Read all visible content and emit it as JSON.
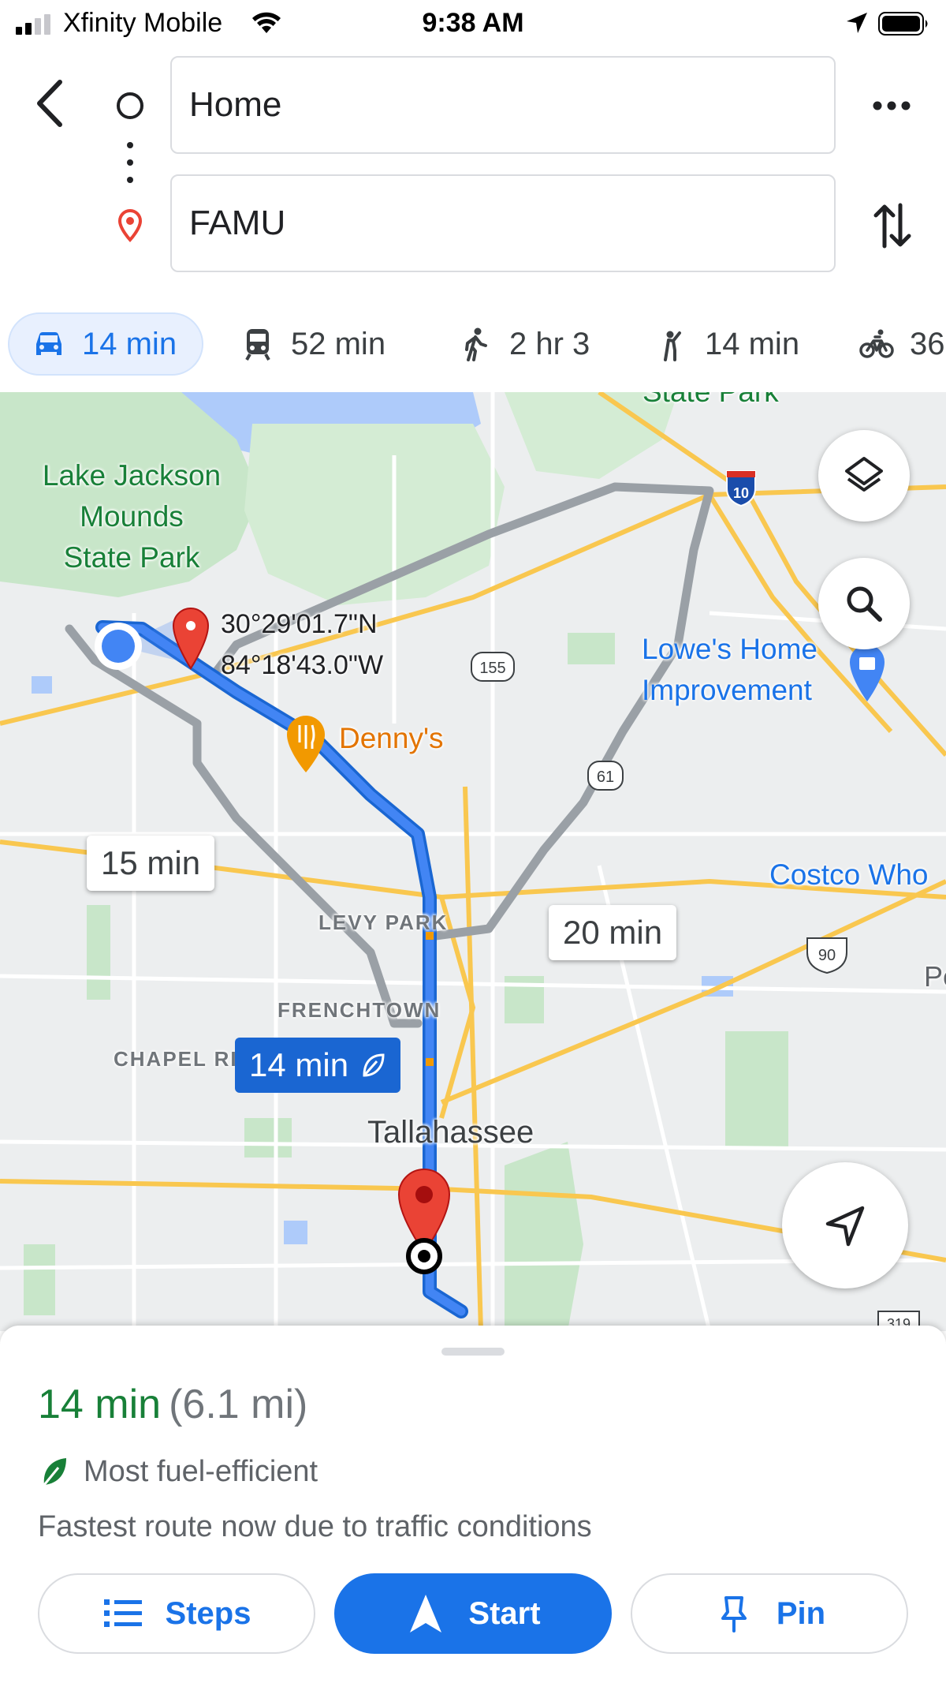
{
  "status_bar": {
    "carrier": "Xfinity Mobile",
    "time": "9:38 AM"
  },
  "header": {
    "origin_value": "Home",
    "destination_value": "FAMU"
  },
  "modes": {
    "drive": "14 min",
    "transit": "52 min",
    "walk": "2 hr 3",
    "ride": "14 min",
    "bike": "36"
  },
  "map": {
    "labels": {
      "park": "Lake Jackson\nMounds\nState Park",
      "park_top": "State Park",
      "coordinates": "30°29'01.7\"N\n84°18'43.0\"W",
      "dennys": "Denny's",
      "lowes": "Lowe's Home\nImprovement",
      "costco": "Costco Who",
      "levy_park": "LEVY PARK",
      "frenchtown": "FRENCHTOWN",
      "chapel": "CHAPEL RI",
      "tallahassee": "Tallahassee",
      "edge_p": "Pe"
    },
    "shields": {
      "i10": "10",
      "sr155": "155",
      "sr61": "61",
      "us90": "90",
      "us319": "319"
    },
    "callouts": {
      "alt_west": "15 min",
      "alt_east": "20 min",
      "selected": "14 min"
    }
  },
  "sheet": {
    "duration": "14 min",
    "distance": "(6.1 mi)",
    "eco_label": "Most fuel-efficient",
    "reason": "Fastest route now due to traffic conditions",
    "steps_label": "Steps",
    "start_label": "Start",
    "pin_label": "Pin"
  },
  "colors": {
    "accent_blue": "#1a73e8",
    "route_blue": "#4285f4",
    "eco_green": "#188038",
    "pin_red": "#ea4335",
    "alt_route_gray": "#9aa0a6"
  },
  "icons": {
    "back": "chevron-left-icon",
    "origin": "circle-outline-icon",
    "destination": "location-pin-icon",
    "more": "more-horizontal-icon",
    "swap": "swap-vertical-icon",
    "drive": "car-icon",
    "transit": "train-icon",
    "walk": "walking-icon",
    "ride": "hail-icon",
    "bike": "bicycle-icon",
    "layers": "layers-icon",
    "search": "search-icon",
    "recenter": "navigation-arrow-icon",
    "eco": "leaf-icon",
    "steps": "list-icon",
    "start": "navigation-icon",
    "pin": "pushpin-icon"
  }
}
